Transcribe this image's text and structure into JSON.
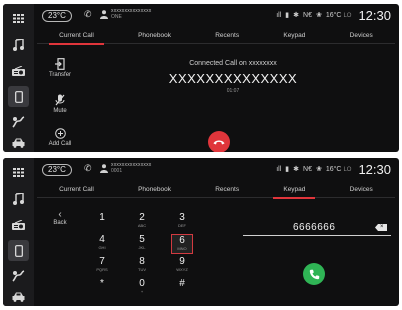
{
  "status": {
    "outside_temp": "23°C",
    "device_name": "xxxxxxxxxxxxxxx",
    "device_sub_1": "ONE",
    "device_sub_2": "0001",
    "right_temp": "16°C",
    "right_temp_sub": "LO",
    "network": "N€",
    "clock": "12:30"
  },
  "tabs": [
    "Current Call",
    "Phonebook",
    "Recents",
    "Keypad",
    "Devices"
  ],
  "current_call": {
    "active_tab": 0,
    "status": "Connected Call on xxxxxxxx",
    "number": "XXXXXXXXXXXXXX",
    "timer": "01:07",
    "actions": [
      "Transfer",
      "Mute",
      "Add Call"
    ]
  },
  "keypad": {
    "active_tab": 3,
    "back_label": "Back",
    "keys": [
      {
        "digit": "1",
        "letters": ""
      },
      {
        "digit": "2",
        "letters": "ABC"
      },
      {
        "digit": "3",
        "letters": "DEF"
      },
      {
        "digit": "4",
        "letters": "GHI"
      },
      {
        "digit": "5",
        "letters": "JKL"
      },
      {
        "digit": "6",
        "letters": "MNO"
      },
      {
        "digit": "7",
        "letters": "PQRS"
      },
      {
        "digit": "8",
        "letters": "TUV"
      },
      {
        "digit": "9",
        "letters": "WXYZ"
      },
      {
        "digit": "*",
        "letters": ""
      },
      {
        "digit": "0",
        "letters": "+"
      },
      {
        "digit": "#",
        "letters": ""
      }
    ],
    "highlighted_key": "6",
    "dial_value": "6666666"
  },
  "colors": {
    "accent": "#e0353b",
    "call_green": "#2fb455",
    "background": "#0f0f10",
    "rail": "#1b1b1d"
  },
  "icons": {
    "rail": [
      "apps-grid-icon",
      "music-icon",
      "radio-icon",
      "phone-icon",
      "navigation-icon",
      "car-icon"
    ],
    "active_rail": "phone-icon"
  }
}
